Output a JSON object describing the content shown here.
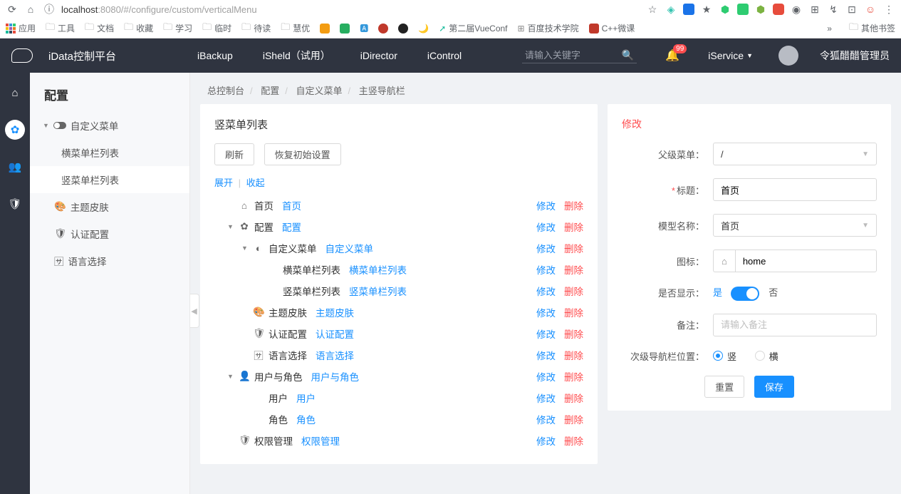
{
  "browser": {
    "url_host": "localhost",
    "url_port": ":8080",
    "url_path": "/#/configure/custom/verticalMenu",
    "apps_label": "应用",
    "bookmarks": [
      "工具",
      "文档",
      "收藏",
      "学习",
      "临时",
      "待读",
      "慧优"
    ],
    "vueconf": "第二届VueConf",
    "baidu": "百度技术学院",
    "cpp": "C++微课",
    "other_bm": "其他书签"
  },
  "header": {
    "brand": "iData控制平台",
    "nav": [
      "iBackup",
      "iSheld（试用）",
      "iDirector",
      "iControl"
    ],
    "search_placeholder": "请输入关键字",
    "badge": "99",
    "iservice": "iService",
    "username": "令狐醋醋管理员"
  },
  "sidebar": {
    "title": "配置",
    "custom_menu": "自定义菜单",
    "horiz_list": "横菜单栏列表",
    "vert_list": "竖菜单栏列表",
    "theme": "主题皮肤",
    "auth": "认证配置",
    "lang": "语言选择"
  },
  "breadcrumb": {
    "a": "总控制台",
    "b": "配置",
    "c": "自定义菜单",
    "d": "主竖导航栏"
  },
  "left": {
    "title": "竖菜单列表",
    "refresh": "刷新",
    "restore": "恢复初始设置",
    "expand": "展开",
    "collapse": "收起",
    "edit": "修改",
    "del": "删除",
    "tree": [
      {
        "indent": 1,
        "caret": "",
        "icon": "⌂",
        "name": "首页",
        "alias": "首页"
      },
      {
        "indent": 1,
        "caret": "▼",
        "icon": "✿",
        "name": "配置",
        "alias": "配置"
      },
      {
        "indent": 2,
        "caret": "▼",
        "icon": "◐",
        "name": "自定义菜单",
        "alias": "自定义菜单"
      },
      {
        "indent": 3,
        "caret": "",
        "icon": "",
        "name": "横菜单栏列表",
        "alias": "横菜单栏列表"
      },
      {
        "indent": 3,
        "caret": "",
        "icon": "",
        "name": "竖菜单栏列表",
        "alias": "竖菜单栏列表"
      },
      {
        "indent": 2,
        "caret": "",
        "icon": "🎨",
        "name": "主题皮肤",
        "alias": "主题皮肤"
      },
      {
        "indent": 2,
        "caret": "",
        "icon": "🛡",
        "name": "认证配置",
        "alias": "认证配置"
      },
      {
        "indent": 2,
        "caret": "",
        "icon": "🈂",
        "name": "语言选择",
        "alias": "语言选择"
      },
      {
        "indent": 1,
        "caret": "▼",
        "icon": "👤",
        "name": "用户与角色",
        "alias": "用户与角色"
      },
      {
        "indent": 2,
        "caret": "",
        "icon": "",
        "name": "用户",
        "alias": "用户"
      },
      {
        "indent": 2,
        "caret": "",
        "icon": "",
        "name": "角色",
        "alias": "角色"
      },
      {
        "indent": 1,
        "caret": "",
        "icon": "🛡",
        "name": "权限管理",
        "alias": "权限管理"
      }
    ]
  },
  "right": {
    "title": "修改",
    "parent_label": "父级菜单：",
    "parent_value": "/",
    "title_label": "标题：",
    "title_value": "首页",
    "model_label": "模型名称：",
    "model_value": "首页",
    "icon_label": "图标：",
    "icon_value": "home",
    "show_label": "是否显示：",
    "show_yes": "是",
    "show_no": "否",
    "remark_label": "备注：",
    "remark_placeholder": "请输入备注",
    "subpos_label": "次级导航栏位置：",
    "subpos_v": "竖",
    "subpos_h": "横",
    "reset": "重置",
    "save": "保存"
  }
}
